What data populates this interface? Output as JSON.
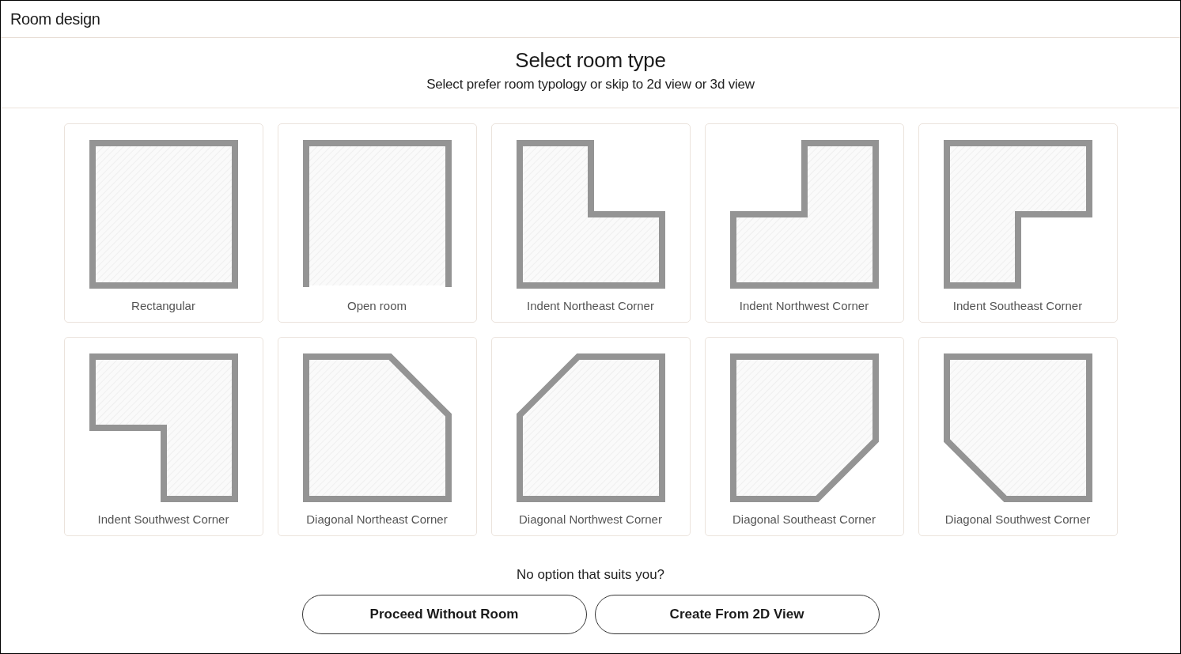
{
  "header": {
    "title": "Room design"
  },
  "intro": {
    "title": "Select room type",
    "subtitle": "Select prefer room typology or skip to 2d view or 3d view"
  },
  "room_types": [
    {
      "label": "Rectangular",
      "kind": "rect"
    },
    {
      "label": "Open room",
      "kind": "open"
    },
    {
      "label": "Indent Northeast Corner",
      "kind": "indent_ne"
    },
    {
      "label": "Indent Northwest Corner",
      "kind": "indent_nw"
    },
    {
      "label": "Indent Southeast Corner",
      "kind": "indent_se"
    },
    {
      "label": "Indent Southwest Corner",
      "kind": "indent_sw"
    },
    {
      "label": "Diagonal Northeast Corner",
      "kind": "diagonal_ne"
    },
    {
      "label": "Diagonal Northwest Corner",
      "kind": "diagonal_nw"
    },
    {
      "label": "Diagonal Southeast Corner",
      "kind": "diagonal_se"
    },
    {
      "label": "Diagonal Southwest Corner",
      "kind": "diagonal_sw"
    }
  ],
  "footer": {
    "prompt": "No option that suits you?",
    "buttons": [
      "Proceed Without Room",
      "Create From 2D View"
    ]
  }
}
